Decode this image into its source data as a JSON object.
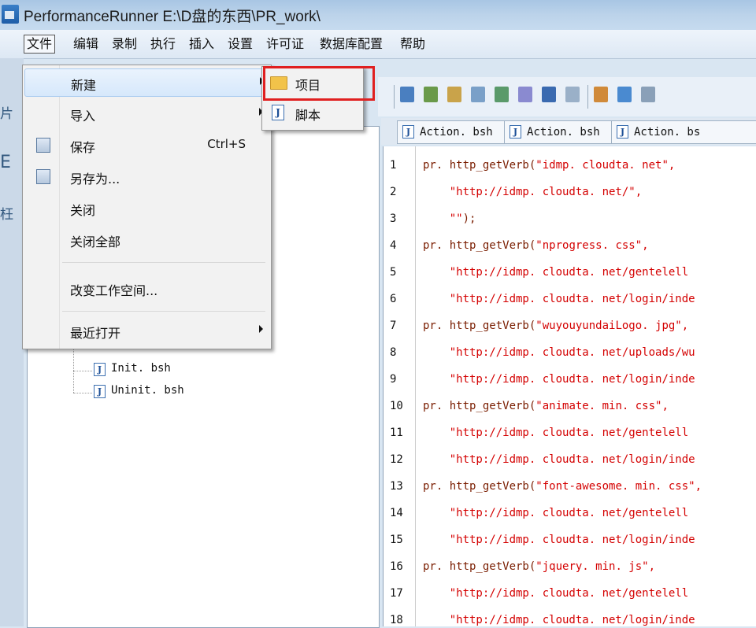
{
  "window": {
    "title": "PerformanceRunner  E:\\D盘的东西\\PR_work\\"
  },
  "menubar": {
    "items": [
      "文件",
      "编辑",
      "录制",
      "执行",
      "插入",
      "设置",
      "许可证",
      "数据库配置",
      "帮助"
    ]
  },
  "file_menu": {
    "items": [
      {
        "label": "新建",
        "has_submenu": true,
        "highlighted": true
      },
      {
        "label": "导入",
        "has_submenu": true
      },
      {
        "label": "保存",
        "shortcut": "Ctrl+S",
        "icon": "save-icon"
      },
      {
        "label": "另存为...",
        "icon": "save-as-icon"
      },
      {
        "label": "关闭"
      },
      {
        "label": "关闭全部"
      },
      {
        "label": "改变工作空间..."
      },
      {
        "label": "最近打开",
        "has_submenu": true
      }
    ]
  },
  "new_submenu": {
    "items": [
      {
        "label": "项目",
        "icon": "folder-icon",
        "highlighted": true
      },
      {
        "label": "脚本",
        "icon": "script-icon"
      }
    ]
  },
  "tree": {
    "files": [
      "Init. bsh",
      "Uninit. bsh"
    ]
  },
  "tabs": [
    "Action. bsh",
    "Action. bsh",
    "Action. bs"
  ],
  "editor": {
    "lines": [
      {
        "n": "1",
        "fn": "pr. http_getVerb(",
        "str": "\"idmp. cloudta. net\",",
        "rest": ""
      },
      {
        "n": "2",
        "fn": "    ",
        "str": "\"http://idmp. cloudta. net/\",",
        "rest": ""
      },
      {
        "n": "3",
        "fn": "    ",
        "str": "\"\"",
        "rest": ");"
      },
      {
        "n": "4",
        "fn": "pr. http_getVerb(",
        "str": "\"nprogress. css\",",
        "rest": ""
      },
      {
        "n": "5",
        "fn": "    ",
        "str": "\"http://idmp. cloudta. net/gentelell",
        "rest": ""
      },
      {
        "n": "6",
        "fn": "    ",
        "str": "\"http://idmp. cloudta. net/login/inde",
        "rest": ""
      },
      {
        "n": "7",
        "fn": "pr. http_getVerb(",
        "str": "\"wuyouyundaiLogo. jpg\",",
        "rest": ""
      },
      {
        "n": "8",
        "fn": "    ",
        "str": "\"http://idmp. cloudta. net/uploads/wu",
        "rest": ""
      },
      {
        "n": "9",
        "fn": "    ",
        "str": "\"http://idmp. cloudta. net/login/inde",
        "rest": ""
      },
      {
        "n": "10",
        "fn": "pr. http_getVerb(",
        "str": "\"animate. min. css\",",
        "rest": ""
      },
      {
        "n": "11",
        "fn": "    ",
        "str": "\"http://idmp. cloudta. net/gentelell",
        "rest": ""
      },
      {
        "n": "12",
        "fn": "    ",
        "str": "\"http://idmp. cloudta. net/login/inde",
        "rest": ""
      },
      {
        "n": "13",
        "fn": "pr. http_getVerb(",
        "str": "\"font-awesome. min. css\",",
        "rest": ""
      },
      {
        "n": "14",
        "fn": "    ",
        "str": "\"http://idmp. cloudta. net/gentelell",
        "rest": ""
      },
      {
        "n": "15",
        "fn": "    ",
        "str": "\"http://idmp. cloudta. net/login/inde",
        "rest": ""
      },
      {
        "n": "16",
        "fn": "pr. http_getVerb(",
        "str": "\"jquery. min. js\",",
        "rest": ""
      },
      {
        "n": "17",
        "fn": "    ",
        "str": "\"http://idmp. cloudta. net/gentelell",
        "rest": ""
      },
      {
        "n": "18",
        "fn": "    ",
        "str": "\"http://idmp. cloudta. net/login/inde",
        "rest": ""
      }
    ]
  },
  "left_strip_chars": [
    "片",
    "E",
    "枉"
  ]
}
